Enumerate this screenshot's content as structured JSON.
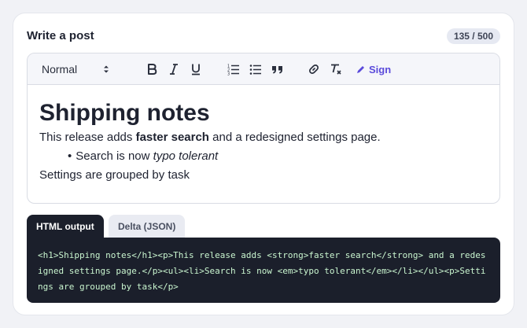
{
  "card": {
    "title": "Write a post",
    "counter": "135 / 500"
  },
  "toolbar": {
    "format_select": "Normal",
    "buttons": [
      "bold",
      "italic",
      "underline",
      "ordered-list",
      "bullet-list",
      "blockquote",
      "link",
      "clear-format"
    ],
    "sign_label": "Sign"
  },
  "content": {
    "heading": "Shipping notes",
    "p1_before": "This release adds ",
    "p1_bold": "faster search",
    "p1_after": " and a redesigned settings page.",
    "li_bullet": "•",
    "li_before": "Search is now ",
    "li_em": "typo tolerant",
    "p2": "Settings are grouped by task"
  },
  "tabs": {
    "html": "HTML output",
    "delta": "Delta (JSON)",
    "active": "html"
  },
  "output": {
    "html": "<h1>Shipping notes</h1><p>This release adds <strong>faster search</strong> and a redesigned settings page.</p><ul><li>Search is now <em>typo tolerant</em></li></ul><p>Settings are grouped by task</p>"
  },
  "colors": {
    "accent": "#5b4bdb",
    "code_bg": "#1b1f2b",
    "code_text": "#c9f5cf"
  }
}
